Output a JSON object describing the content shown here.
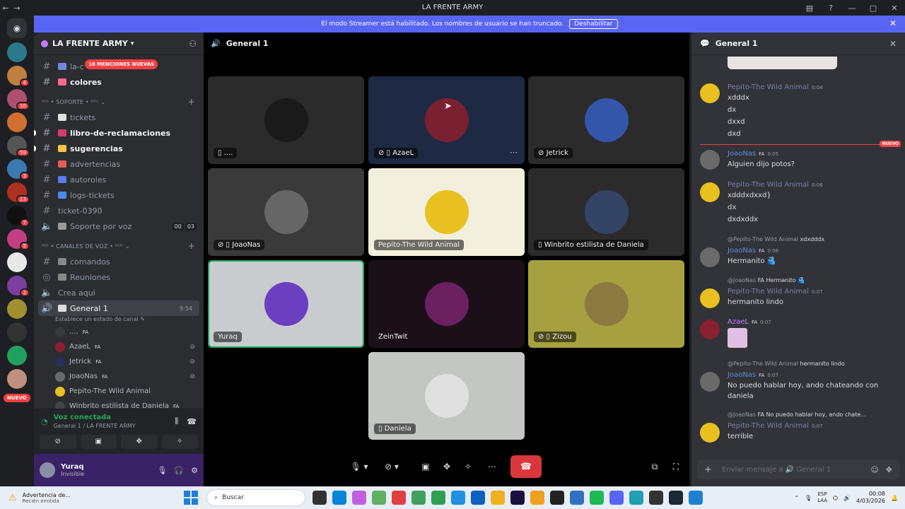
{
  "window": {
    "title": "LA FRENTE ARMY"
  },
  "streamer_bar": {
    "text": "El modo Streamer está habilitado. Los nombres de usuario se han truncado.",
    "button": "Deshabilitar"
  },
  "guild_badges": [
    "4",
    "10",
    "59",
    "3",
    "13",
    "7",
    "5",
    "2"
  ],
  "guild_nuevo": "NUEVO",
  "server": {
    "name": "LA FRENTE ARMY",
    "mentions_pill": "10 MENCIONES NUEVAS"
  },
  "channels_top": [
    {
      "name": "la-c",
      "emoji_color": "#7289da"
    },
    {
      "name": "colores",
      "emoji_color": "#ff6b8a",
      "unread": true
    }
  ],
  "cat_soporte": "⁾⁾⁾⁾⁾ • SOPORTE • ⁽⁽⁽⁽⁽",
  "channels_soporte": [
    {
      "name": "tickets",
      "emoji_color": "#e0e0e0"
    },
    {
      "name": "libro-de-reclamaciones",
      "emoji_color": "#d63b6a",
      "unread": true
    },
    {
      "name": "sugerencias",
      "emoji_color": "#f5c542",
      "unread": true
    },
    {
      "name": "advertencias",
      "emoji_color": "#e85a5a"
    },
    {
      "name": "autoroles",
      "emoji_color": "#5a7be8"
    },
    {
      "name": "logs-tickets",
      "emoji_color": "#4a8be8"
    },
    {
      "name": "ticket-0390",
      "emoji_color": ""
    }
  ],
  "voice_soporte": {
    "name": "Soporte por voz",
    "count_a": "00",
    "count_b": "03"
  },
  "cat_voz": "⁾⁾⁾⁾⁾ • CANALES DE VOZ • ⁽⁽⁽⁽⁽",
  "channels_voz": [
    {
      "name": "comandos"
    },
    {
      "name": "Reuniones"
    },
    {
      "name": "Crea aquí"
    }
  ],
  "active_voice": {
    "name": "General 1",
    "time": "9:54",
    "status": "Establece un estado de canal"
  },
  "voice_users": [
    {
      "name": "....",
      "tag": "FA",
      "color": "#3a3a3a",
      "muted": false
    },
    {
      "name": "AzaeL",
      "tag": "FA",
      "color": "#8b2030",
      "muted": true
    },
    {
      "name": "Jetrick",
      "tag": "FA",
      "color": "#223355",
      "muted": true
    },
    {
      "name": "JoaoNas",
      "tag": "FA",
      "color": "#6a6a6a",
      "muted": true
    },
    {
      "name": "Pepito-The Wild Animal",
      "tag": "",
      "color": "#e8c020",
      "muted": false
    },
    {
      "name": "Winbrito estilista de Daniela",
      "tag": "FA",
      "color": "#444",
      "muted": false
    }
  ],
  "voice_panel": {
    "title": "Voz conectada",
    "subtitle": "General 1 / LA FRENTE ARMY"
  },
  "user_panel": {
    "name": "Yuraq",
    "status": "Invisible"
  },
  "stage": {
    "title": "General 1"
  },
  "tiles": [
    {
      "name": "....",
      "bg": "#2b2b2b",
      "av": "#1a1a1a",
      "icon": "▯"
    },
    {
      "name": "AzaeL",
      "bg": "#1e2a44",
      "av": "#7a2030",
      "icon": "⊘ ▯"
    },
    {
      "name": "Jetrick",
      "bg": "#2b2b2b",
      "av": "#3355aa",
      "icon": "⊘"
    },
    {
      "name": "JoaoNas",
      "bg": "#3a3a3a",
      "av": "#666",
      "icon": "⊘ ▯"
    },
    {
      "name": "Pepito-The Wild Animal",
      "bg": "#f2f0dc",
      "av": "#e8c020",
      "icon": ""
    },
    {
      "name": "Winbrito estilista de Daniela",
      "bg": "#2b2b2b",
      "av": "#334466",
      "icon": "▯"
    },
    {
      "name": "Yuraq",
      "bg": "#c8cccf",
      "av": "#6a40c0",
      "icon": ""
    },
    {
      "name": "ZeinTwit",
      "bg": "#1c1018",
      "av": "#6b2060",
      "icon": ""
    },
    {
      "name": "Zizou",
      "bg": "#a6a040",
      "av": "#8a7a40",
      "icon": "⊘ ▯"
    },
    {
      "name": "Daniela",
      "bg": "#c4c6c4",
      "av": "#e0e0e0",
      "icon": "▯"
    }
  ],
  "chat": {
    "title": "General 1",
    "new_label": "NUEVO",
    "composer": "Enviar mensaje a 🔊 General 1",
    "messages": [
      {
        "author": "Pepito-The Wild Animal",
        "tags": "",
        "time": "0:04",
        "lines": [
          "xdddx",
          "dx",
          "dxxd",
          "dxd"
        ]
      },
      {
        "author": "JoaoNas",
        "tags": "FA",
        "time": "0:05",
        "lines": [
          "Alguien dijo potos?"
        ]
      },
      {
        "author": "Pepito-The Wild Animal",
        "tags": "",
        "time": "0:06",
        "lines": [
          "xdddxdxxd}",
          "dx",
          "dxdxddx"
        ]
      },
      {
        "reply_to": "@Pepito-The Wild Animal",
        "reply_text": "xdxdddx",
        "author": "JoaoNas",
        "tags": "FA",
        "time": "0:06",
        "lines": [
          "Hermanito 🫂"
        ]
      },
      {
        "reply_to": "@JoaoNas",
        "reply_text": "FA Hermanito 🫂",
        "author": "Pepito-The Wild Animal",
        "tags": "",
        "time": "0:07",
        "lines": [
          "hermanito lindo"
        ]
      },
      {
        "author": "AzaeL",
        "tags": "FA",
        "time": "0:07",
        "lines": []
      },
      {
        "reply_to": "@Pepito-The Wild Animal",
        "reply_text": "hermanito lindo",
        "author": "JoaoNas",
        "tags": "FA",
        "time": "0:07",
        "lines": [
          "No puedo hablar hoy, ando chateando con",
          "daniela"
        ]
      },
      {
        "reply_to": "@JoaoNas",
        "reply_text": "FA No puedo hablar hoy, ando chate...",
        "author": "Pepito-The Wild Animal",
        "tags": "",
        "time": "0:07",
        "lines": [
          "terrible"
        ]
      }
    ]
  },
  "taskbar": {
    "notif_title": "Advertencia de...",
    "notif_sub": "Recién emitida",
    "search": "Buscar",
    "lang_a": "ESP",
    "lang_b": "LAA",
    "time": "00:08",
    "date": "4/03/2026"
  }
}
